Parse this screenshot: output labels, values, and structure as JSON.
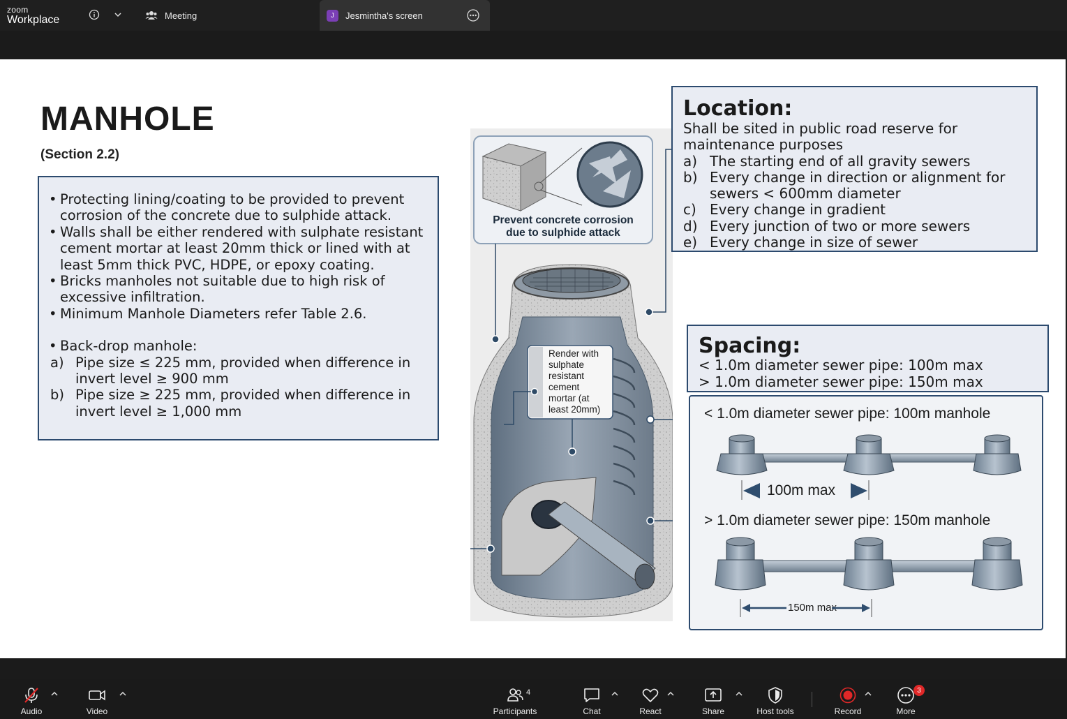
{
  "app": {
    "brand_small": "zoom",
    "brand_name": "Workplace"
  },
  "tabs": {
    "meeting": "Meeting",
    "screen": "Jesmintha's screen",
    "screen_initial": "J"
  },
  "slide": {
    "title": "MANHOLE",
    "section": "(Section 2.2)",
    "bullets": [
      "Protecting lining/coating to be provided to prevent corrosion of the concrete due to sulphide attack.",
      "Walls shall be either rendered with sulphate resistant cement mortar at least 20mm thick or lined with at least 5mm thick PVC, HDPE, or epoxy coating.",
      "Bricks manholes not suitable due to high risk of excessive infiltration.",
      "Minimum Manhole Diameters refer Table 2.6."
    ],
    "backdrop": {
      "heading": "Back-drop manhole:",
      "items": [
        {
          "letter": "a)",
          "text": "Pipe size ≤ 225 mm, provided when difference in invert level ≥ 900 mm"
        },
        {
          "letter": "b)",
          "text": "Pipe size ≥ 225 mm, provided when difference in invert level ≥ 1,000 mm"
        }
      ]
    },
    "illustration": {
      "callout_top": "Prevent concrete corrosion due to sulphide attack",
      "callout_render": [
        "Render with",
        "sulphate",
        "resistant",
        "cement",
        "mortar (at",
        "least 20mm)"
      ]
    },
    "location": {
      "heading": "Location:",
      "intro": "Shall be sited in public road reserve for maintenance purposes",
      "items": [
        {
          "letter": "a)",
          "text": "The starting end of all gravity sewers"
        },
        {
          "letter": "b)",
          "text": "Every change in direction or alignment for sewers < 600mm diameter"
        },
        {
          "letter": "c)",
          "text": "Every change in gradient"
        },
        {
          "letter": "d)",
          "text": "Every junction of two or more sewers"
        },
        {
          "letter": "e)",
          "text": "Every change in size of sewer"
        }
      ]
    },
    "spacing": {
      "heading": "Spacing:",
      "lines": [
        "< 1.0m diameter sewer pipe: 100m max",
        "> 1.0m diameter sewer pipe: 150m max"
      ],
      "diagram": {
        "label_1": "< 1.0m diameter sewer pipe: 100m manhole",
        "dim_1": "100m max",
        "label_2": "> 1.0m diameter sewer pipe: 150m manhole",
        "dim_2": "150m max"
      }
    }
  },
  "toolbar": {
    "audio": "Audio",
    "video": "Video",
    "participants": "Participants",
    "participants_count": "4",
    "chat": "Chat",
    "react": "React",
    "share": "Share",
    "host_tools": "Host tools",
    "record": "Record",
    "more": "More",
    "more_badge": "3"
  },
  "colors": {
    "panel_border": "#2c4a6e",
    "panel_fill": "#e9ecf3",
    "record_red": "#e02828"
  }
}
